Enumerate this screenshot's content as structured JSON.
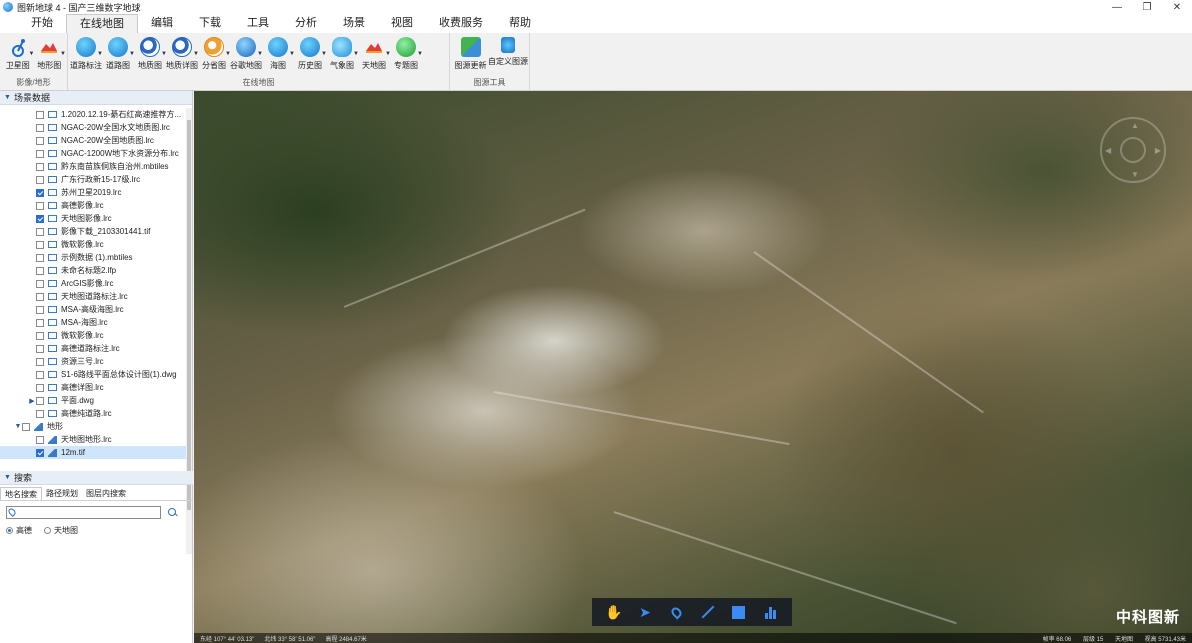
{
  "window": {
    "title": "图新地球 4 - 国产三维数字地球",
    "minimize": "—",
    "restore": "❐",
    "close": "✕"
  },
  "menu": {
    "tabs": [
      "开始",
      "在线地图",
      "编辑",
      "下载",
      "工具",
      "分析",
      "场景",
      "视图",
      "收费服务",
      "帮助"
    ],
    "active_index": 1
  },
  "ribbon": {
    "groups": [
      {
        "label": "影像/地形",
        "buttons": [
          {
            "label": "卫星图",
            "icon": "satellite-icon"
          },
          {
            "label": "地形图",
            "icon": "terrain-icon"
          }
        ]
      },
      {
        "label": "在线地图",
        "buttons": [
          {
            "label": "道路标注",
            "icon": "road-label-icon"
          },
          {
            "label": "道路图",
            "icon": "road-map-icon"
          },
          {
            "label": "地质图",
            "icon": "geology-map-icon"
          },
          {
            "label": "地质详图",
            "icon": "geology-detail-icon"
          },
          {
            "label": "分省图",
            "icon": "province-map-icon"
          },
          {
            "label": "谷歌地图",
            "icon": "google-map-icon"
          },
          {
            "label": "海图",
            "icon": "sea-chart-icon"
          },
          {
            "label": "历史图",
            "icon": "history-map-icon"
          },
          {
            "label": "气象图",
            "icon": "weather-map-icon"
          },
          {
            "label": "天地图",
            "icon": "tianditu-icon"
          },
          {
            "label": "专题图",
            "icon": "thematic-map-icon"
          }
        ]
      },
      {
        "label": "图源工具",
        "buttons": [
          {
            "label": "图源更新",
            "icon": "source-update-icon"
          },
          {
            "label": "自定义图源",
            "icon": "custom-source-icon"
          }
        ]
      }
    ]
  },
  "scene_panel": {
    "title": "场景数据",
    "items": [
      {
        "label": "1.2020.12.19-綦石红高速推荐方...",
        "checked": false,
        "indent": 2,
        "type": "file"
      },
      {
        "label": "NGAC-20W全国水文地质图.lrc",
        "checked": false,
        "indent": 2,
        "type": "file"
      },
      {
        "label": "NGAC-20W全国地质图.lrc",
        "checked": false,
        "indent": 2,
        "type": "file"
      },
      {
        "label": "NGAC-1200W地下水资源分布.lrc",
        "checked": false,
        "indent": 2,
        "type": "file"
      },
      {
        "label": "黔东南苗族侗族自治州.mbtiles",
        "checked": false,
        "indent": 2,
        "type": "file"
      },
      {
        "label": "广东行政新15-17级.lrc",
        "checked": false,
        "indent": 2,
        "type": "file"
      },
      {
        "label": "苏州卫星2019.lrc",
        "checked": true,
        "indent": 2,
        "type": "file"
      },
      {
        "label": "高德影像.lrc",
        "checked": false,
        "indent": 2,
        "type": "file"
      },
      {
        "label": "天地图影像.lrc",
        "checked": true,
        "indent": 2,
        "type": "file"
      },
      {
        "label": "影像下载_2103301441.tif",
        "checked": false,
        "indent": 2,
        "type": "file"
      },
      {
        "label": "微软影像.lrc",
        "checked": false,
        "indent": 2,
        "type": "file"
      },
      {
        "label": "示例数据 (1).mbtiles",
        "checked": false,
        "indent": 2,
        "type": "file"
      },
      {
        "label": "未命名标题2.lfp",
        "checked": false,
        "indent": 2,
        "type": "file"
      },
      {
        "label": "ArcGIS影像.lrc",
        "checked": false,
        "indent": 2,
        "type": "file"
      },
      {
        "label": "天地图道路标注.lrc",
        "checked": false,
        "indent": 2,
        "type": "file"
      },
      {
        "label": "MSA-高级海图.lrc",
        "checked": false,
        "indent": 2,
        "type": "file"
      },
      {
        "label": "MSA-海图.lrc",
        "checked": false,
        "indent": 2,
        "type": "file"
      },
      {
        "label": "微软影像.lrc",
        "checked": false,
        "indent": 2,
        "type": "file"
      },
      {
        "label": "高德道路标注.lrc",
        "checked": false,
        "indent": 2,
        "type": "file"
      },
      {
        "label": "资源三号.lrc",
        "checked": false,
        "indent": 2,
        "type": "file"
      },
      {
        "label": "S1-6路线平面总体设计图(1).dwg",
        "checked": false,
        "indent": 2,
        "type": "file"
      },
      {
        "label": "高德详图.lrc",
        "checked": false,
        "indent": 2,
        "type": "file"
      },
      {
        "label": "平面.dwg",
        "checked": false,
        "indent": 2,
        "type": "file",
        "expandable": true
      },
      {
        "label": "高德纯道路.lrc",
        "checked": false,
        "indent": 2,
        "type": "file"
      },
      {
        "label": "地形",
        "checked": false,
        "indent": 1,
        "type": "folder",
        "expanded": true
      },
      {
        "label": "天地图地形.lrc",
        "checked": false,
        "indent": 2,
        "type": "terrain"
      },
      {
        "label": "12m.tif",
        "checked": true,
        "indent": 2,
        "type": "terrain",
        "selected": true
      }
    ]
  },
  "search_panel": {
    "title": "搜索",
    "tabs": [
      "地名搜索",
      "路径规划",
      "图层内搜索"
    ],
    "active_tab": 0,
    "input_value": "",
    "input_placeholder": "",
    "sources": [
      "高德",
      "天地图"
    ],
    "selected_source": 0
  },
  "map": {
    "tools": [
      "pan-hand-icon",
      "select-arrow-icon",
      "placemark-icon",
      "line-icon",
      "polygon-icon",
      "elevation-profile-icon"
    ],
    "watermark": "中科图新",
    "status": {
      "lon": "东经 107° 44' 03.13\"",
      "lat": "北纬 33° 58' 51.06\"",
      "elev": "高程 2484.67米",
      "fps": "帧率 68.06",
      "level": "层级 15",
      "provider": "天地图",
      "eye_alt": "视高 5731.43米"
    }
  },
  "colors": {
    "accent": "#2a6ecf",
    "tool_blue": "#3b8cf2",
    "selected_row": "#cfe5fb"
  }
}
